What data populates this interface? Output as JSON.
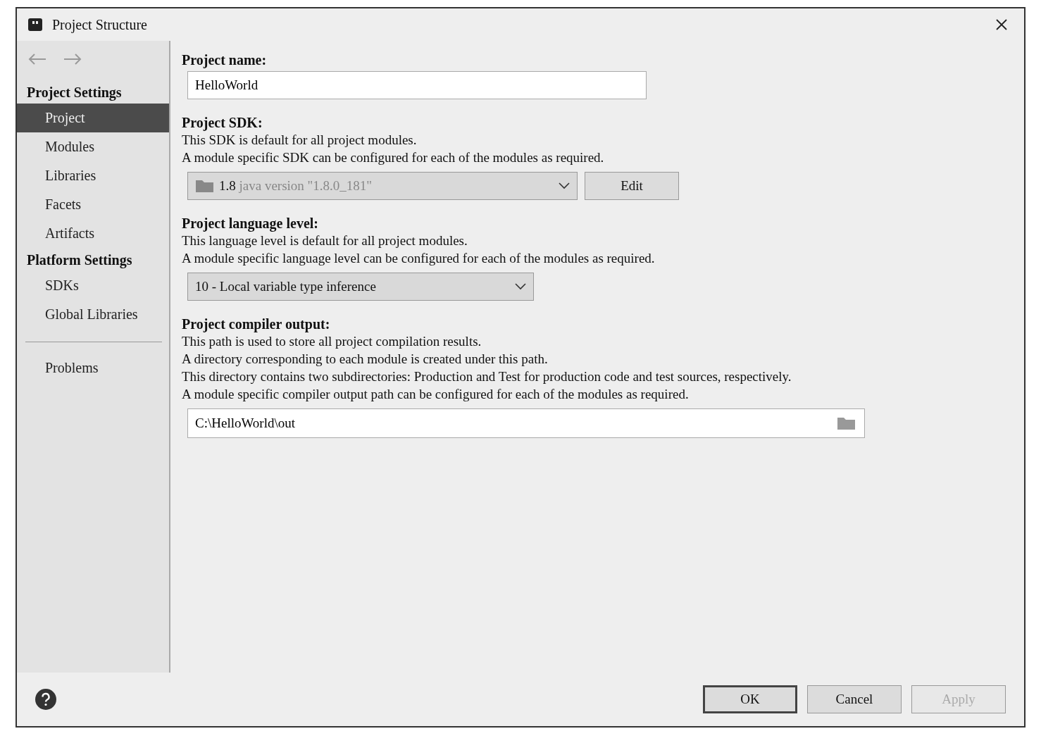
{
  "window": {
    "title": "Project Structure"
  },
  "sidebar": {
    "sections": [
      {
        "header": "Project Settings",
        "items": [
          {
            "label": "Project",
            "selected": true
          },
          {
            "label": "Modules",
            "selected": false
          },
          {
            "label": "Libraries",
            "selected": false
          },
          {
            "label": "Facets",
            "selected": false
          },
          {
            "label": "Artifacts",
            "selected": false
          }
        ]
      },
      {
        "header": "Platform Settings",
        "items": [
          {
            "label": "SDKs",
            "selected": false
          },
          {
            "label": "Global Libraries",
            "selected": false
          }
        ]
      }
    ],
    "footer_items": [
      {
        "label": "Problems",
        "selected": false
      }
    ]
  },
  "project_name": {
    "label": "Project name:",
    "value": "HelloWorld"
  },
  "project_sdk": {
    "label": "Project SDK:",
    "descriptions": [
      "This SDK is default for all project modules.",
      "A module specific SDK can be configured for each of the modules as required."
    ],
    "version": "1.8",
    "detail": "java version \"1.8.0_181\"",
    "edit_button": "Edit"
  },
  "language_level": {
    "label": "Project language level:",
    "descriptions": [
      "This language level is default for all project modules.",
      "A module specific language level can be configured for each of the modules as required."
    ],
    "value": "10 - Local variable type inference"
  },
  "compiler_output": {
    "label": "Project compiler output:",
    "descriptions": [
      "This path is used to store all project compilation results.",
      "A directory corresponding to each module is created under this path.",
      "This directory contains two subdirectories: Production and Test for production code and test sources, respectively.",
      "A module specific compiler output path can be configured for each of the modules as required."
    ],
    "value": "C:\\HelloWorld\\out"
  },
  "buttons": [
    {
      "label": "OK",
      "kind": "default",
      "disabled": false
    },
    {
      "label": "Cancel",
      "kind": "normal",
      "disabled": false
    },
    {
      "label": "Apply",
      "kind": "normal",
      "disabled": true
    }
  ]
}
